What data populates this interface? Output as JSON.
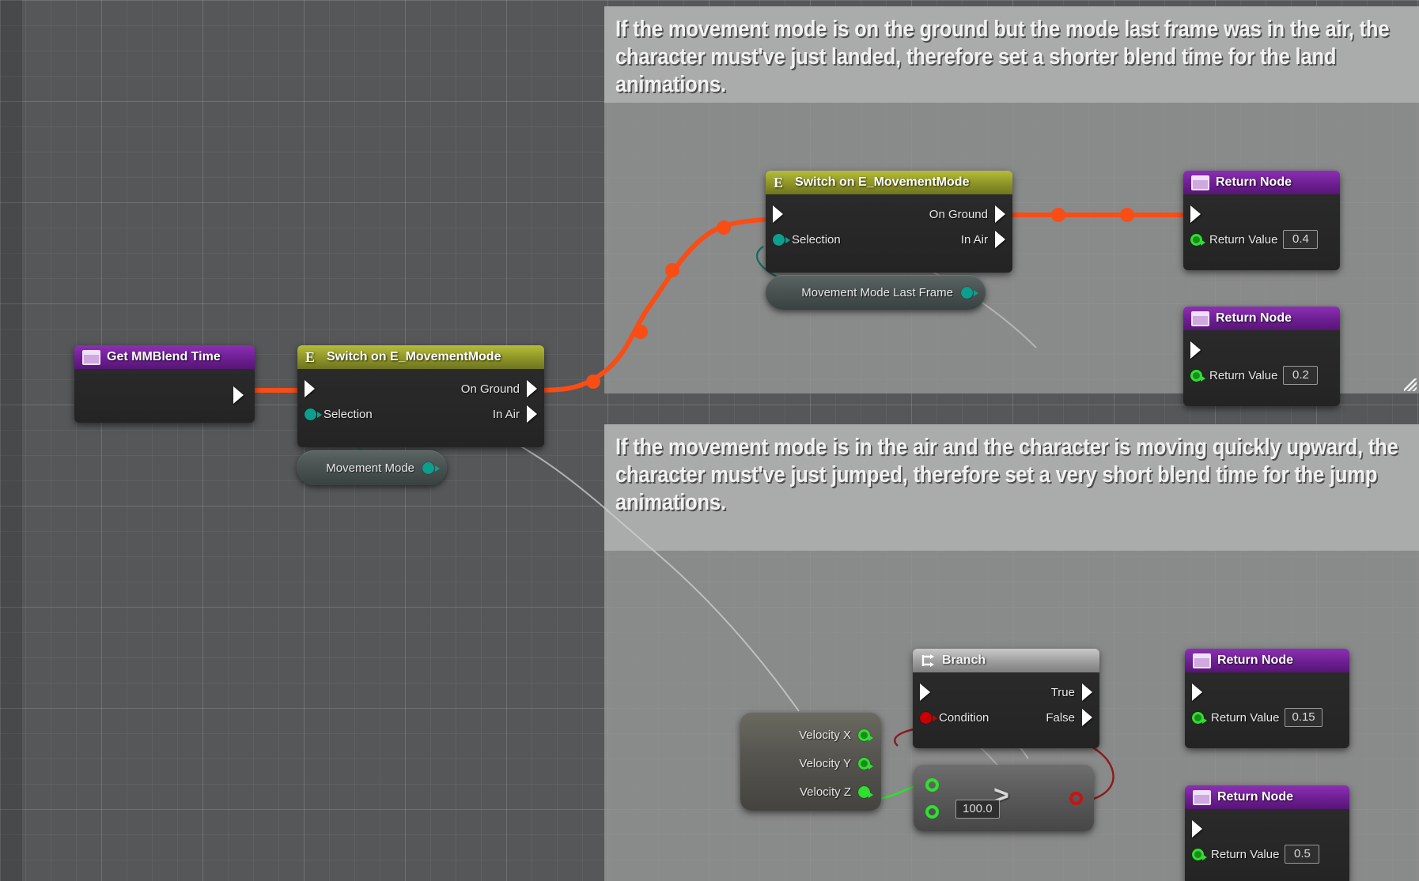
{
  "graph": {
    "background_color": "#555759",
    "grid_color": "#6a6c6e"
  },
  "comments": [
    {
      "id": "comment-landed",
      "text": "If the movement mode is on the ground but the mode last frame was in the air, the character must've just landed, therefore set a shorter blend time for the land animations.",
      "header_color": "#b0b0b0",
      "body_color": "#989898"
    },
    {
      "id": "comment-jumped",
      "text": "If the movement mode is in the air and the character is moving quickly upward, the character must've just jumped, therefore set a very short blend time for the jump animations.",
      "header_color": "#b0b0b0",
      "body_color": "#989898"
    }
  ],
  "nodes": {
    "get_blend_time": {
      "title": "Get MMBlend Time",
      "icon": "function-icon",
      "header_color": "#6d1f92"
    },
    "switch_main": {
      "title": "Switch on E_MovementMode",
      "icon": "switch-enum-icon",
      "header_color": "#8e9426",
      "input_exec": "",
      "selection_label": "Selection",
      "out_on_ground": "On Ground",
      "out_in_air": "In Air"
    },
    "var_movement_mode": {
      "label": "Movement Mode",
      "pin_color": "#0e9e8e"
    },
    "switch_last_frame": {
      "title": "Switch on E_MovementMode",
      "icon": "switch-enum-icon",
      "header_color": "#8e9426",
      "selection_label": "Selection",
      "out_on_ground": "On Ground",
      "out_in_air": "In Air"
    },
    "var_movement_mode_last_frame": {
      "label": "Movement Mode Last Frame",
      "pin_color": "#0e9e8e"
    },
    "return_04": {
      "title": "Return Node",
      "icon": "function-icon",
      "value_label": "Return Value",
      "value": "0.4"
    },
    "return_02": {
      "title": "Return Node",
      "icon": "function-icon",
      "value_label": "Return Value",
      "value": "0.2"
    },
    "branch": {
      "title": "Branch",
      "icon": "branch-icon",
      "condition_label": "Condition",
      "out_true": "True",
      "out_false": "False",
      "header_color": "#9d9d9d",
      "condition_pin_color": "#c80000"
    },
    "velocity": {
      "out_x": "Velocity X",
      "out_y": "Velocity Y",
      "out_z": "Velocity Z",
      "pin_color": "#2fe02f"
    },
    "compare_greater": {
      "glyph": ">",
      "value": "100.0",
      "input_pin_color": "#2fe02f",
      "output_pin_color": "#c81414"
    },
    "return_015": {
      "title": "Return Node",
      "icon": "function-icon",
      "value_label": "Return Value",
      "value": "0.15"
    },
    "return_05": {
      "title": "Return Node",
      "icon": "function-icon",
      "value_label": "Return Value",
      "value": "0.5"
    }
  },
  "wire_colors": {
    "exec": "#f94d16",
    "enum": "#1a6b63",
    "float": "#2fe02f",
    "bool": "#8c1a1a",
    "generic": "#d4d4d4"
  }
}
